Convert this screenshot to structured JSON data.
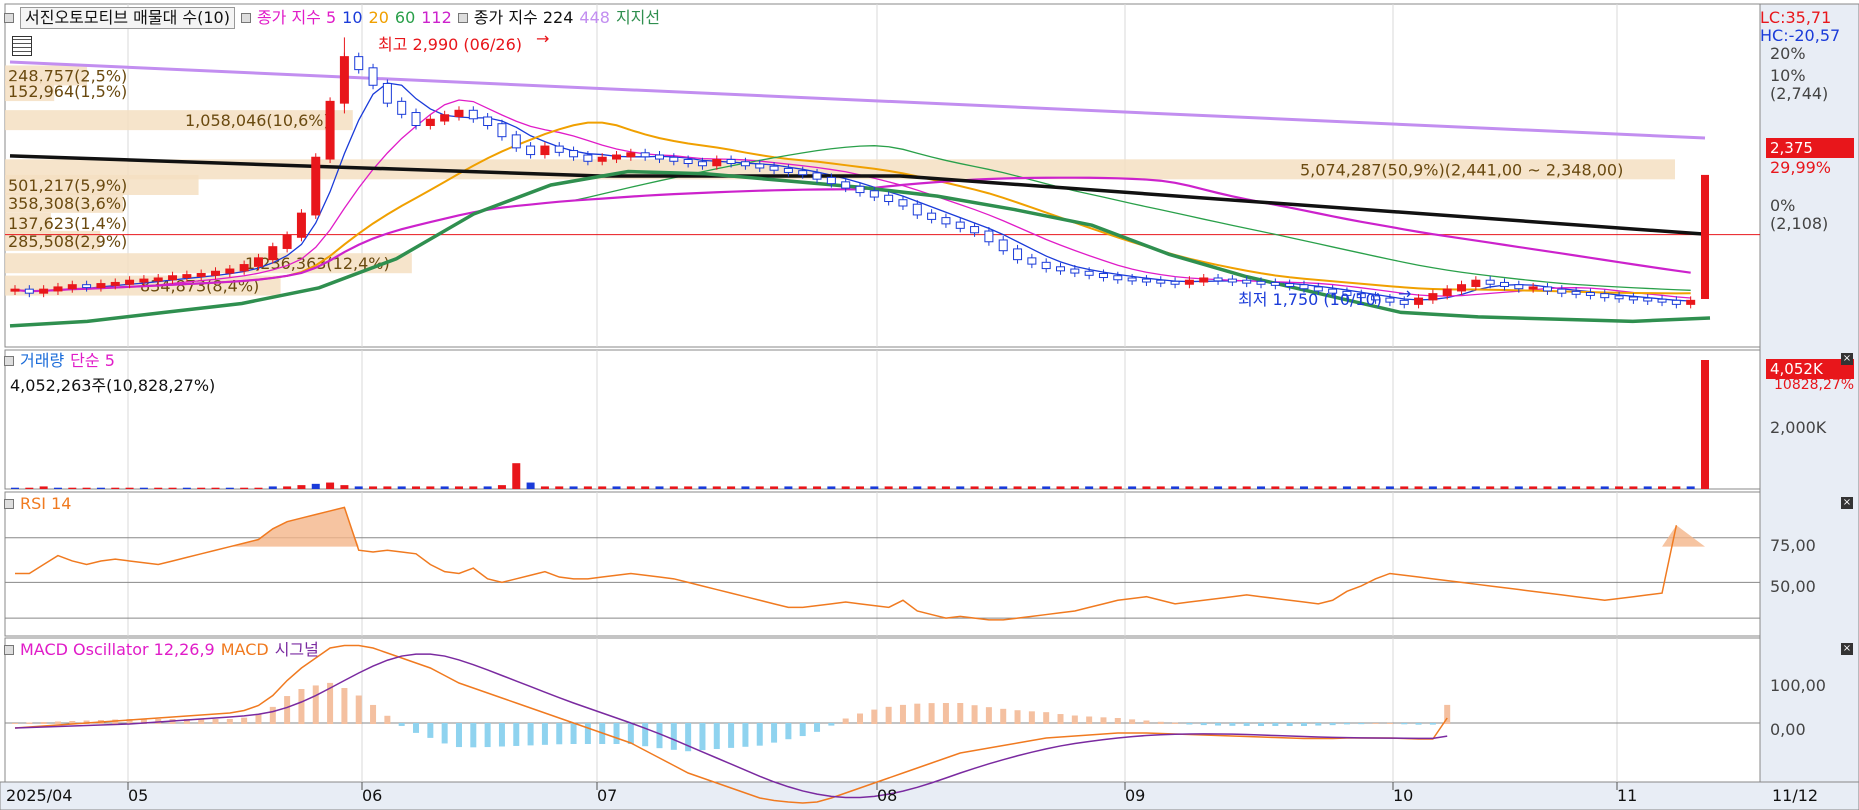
{
  "colors": {
    "up": "#e8161b",
    "down": "#1a3bd9",
    "ma5": "#1a3bd9",
    "ma10": "#e01cc8",
    "ma20": "#f0a000",
    "ma60": "#2aa04a",
    "ma112": "#cc22cc",
    "ma224": "#111111",
    "ma448": "#c28ef0",
    "support": "#2f8f4f",
    "rsi": "#f07a20",
    "macd": "#f07a20",
    "signal": "#7a2aa0"
  },
  "icons": {
    "grid": "grid-icon",
    "close": "close-icon",
    "arrow": "arrow-right-icon"
  },
  "price_panel": {
    "title": "서진오토모티브 매물대 수(10)",
    "legend": [
      {
        "label": "종가 지수 5",
        "color": "#e01cc8"
      },
      {
        "label": "10",
        "color": "#1a3bd9"
      },
      {
        "label": "20",
        "color": "#f0a000"
      },
      {
        "label": "60",
        "color": "#2aa04a"
      },
      {
        "label": "112",
        "color": "#cc22cc"
      }
    ],
    "legend2": [
      {
        "label": "종가 지수 224",
        "color": "#111111"
      },
      {
        "label": "448",
        "color": "#c28ef0"
      },
      {
        "label": "지지선",
        "color": "#2f8f4f"
      }
    ],
    "high_label": "최고 2,990 (06/26)",
    "low_label": "최저 1,750 (10/10)",
    "lc": "LC:35,71",
    "hc": "HC:-20,57",
    "current_price": "2,375",
    "current_pct": "29,99%",
    "axis": {
      "top": "20%",
      "pct10": "10%",
      "p10val": "(2,744)",
      "zero": "0%",
      "zeroval": "(2,108)"
    },
    "volume_profile": [
      {
        "label": "248,757(2,5%)",
        "price": 2820,
        "share": 2.5
      },
      {
        "label": "152,964(1,5%)",
        "price": 2750,
        "share": 1.5
      },
      {
        "label": "1,058,046(10,6%)",
        "price": 2620,
        "share": 10.6
      },
      {
        "label": "5,074,287(50,9%)(2,441,00 ~ 2,348,00)",
        "price": 2400,
        "share": 50.9
      },
      {
        "label": "501,217(5,9%)",
        "price": 2330,
        "share": 5.9
      },
      {
        "label": "358,308(3,6%)",
        "price": 2250,
        "share": 3.6
      },
      {
        "label": "137,623(1,4%)",
        "price": 2160,
        "share": 1.4
      },
      {
        "label": "285,508(2,9%)",
        "price": 2080,
        "share": 2.9
      },
      {
        "label": "1,236,363(12,4%)",
        "price": 1980,
        "share": 12.4
      },
      {
        "label": "834,873(8,4%)",
        "price": 1880,
        "share": 8.4
      }
    ]
  },
  "volume_panel": {
    "legend": [
      {
        "label": "거래량",
        "color": "#1a6bd9"
      },
      {
        "label": "단순 5",
        "color": "#e01cc8"
      }
    ],
    "info": "4,052,263주(10,828,27%)",
    "current": "4,052K",
    "current_pct": "10828,27%",
    "axis_label": "2,000K"
  },
  "rsi_panel": {
    "legend": "RSI 14",
    "axis": [
      "75,00",
      "50,00"
    ]
  },
  "macd_panel": {
    "legend": [
      {
        "label": "MACD Oscillator 12,26,9",
        "color": "#e01cc8"
      },
      {
        "label": "MACD",
        "color": "#f07a20"
      },
      {
        "label": "시그널",
        "color": "#7a2aa0"
      }
    ],
    "axis": [
      "100,00",
      "0,00"
    ]
  },
  "x_axis": {
    "labels": [
      "2025/04",
      "05",
      "06",
      "07",
      "08",
      "09",
      "10",
      "11"
    ],
    "right_label": "11/12"
  },
  "chart_data": {
    "type": "candlestick",
    "title": "서진오토모티브",
    "ylim": [
      1650,
      3050
    ],
    "closes": [
      1860,
      1850,
      1860,
      1870,
      1880,
      1875,
      1885,
      1890,
      1900,
      1905,
      1910,
      1920,
      1925,
      1930,
      1940,
      1950,
      1970,
      2000,
      2050,
      2100,
      2200,
      2450,
      2700,
      2900,
      2850,
      2780,
      2700,
      2650,
      2600,
      2620,
      2640,
      2660,
      2630,
      2600,
      2550,
      2500,
      2470,
      2500,
      2480,
      2460,
      2440,
      2450,
      2460,
      2470,
      2460,
      2450,
      2440,
      2430,
      2420,
      2440,
      2430,
      2420,
      2410,
      2400,
      2390,
      2380,
      2360,
      2340,
      2320,
      2300,
      2280,
      2260,
      2240,
      2200,
      2180,
      2160,
      2140,
      2120,
      2080,
      2040,
      2000,
      1980,
      1960,
      1950,
      1940,
      1930,
      1920,
      1910,
      1905,
      1900,
      1895,
      1890,
      1900,
      1910,
      1905,
      1900,
      1895,
      1890,
      1885,
      1880,
      1870,
      1860,
      1850,
      1840,
      1830,
      1820,
      1810,
      1800,
      1820,
      1840,
      1860,
      1880,
      1900,
      1890,
      1880,
      1870,
      1870,
      1860,
      1850,
      1845,
      1840,
      1830,
      1825,
      1820,
      1815,
      1810,
      1800,
      1810,
      2375
    ],
    "volume_rel": [
      0.01,
      0.01,
      0.02,
      0.01,
      0.01,
      0.01,
      0.01,
      0.01,
      0.01,
      0.01,
      0.01,
      0.01,
      0.01,
      0.01,
      0.01,
      0.01,
      0.01,
      0.01,
      0.02,
      0.02,
      0.03,
      0.04,
      0.05,
      0.03,
      0.02,
      0.02,
      0.02,
      0.02,
      0.02,
      0.02,
      0.02,
      0.02,
      0.02,
      0.02,
      0.03,
      0.2,
      0.05,
      0.02,
      0.02,
      0.02,
      0.02,
      0.02,
      0.02,
      0.02,
      0.02,
      0.02,
      0.02,
      0.02,
      0.02,
      0.02,
      0.02,
      0.02,
      0.02,
      0.02,
      0.02,
      0.02,
      0.02,
      0.02,
      0.02,
      0.02,
      0.02,
      0.02,
      0.02,
      0.02,
      0.02,
      0.02,
      0.02,
      0.02,
      0.02,
      0.02,
      0.02,
      0.02,
      0.02,
      0.02,
      0.02,
      0.02,
      0.02,
      0.02,
      0.02,
      0.02,
      0.02,
      0.02,
      0.02,
      0.02,
      0.02,
      0.02,
      0.02,
      0.02,
      0.02,
      0.02,
      0.02,
      0.02,
      0.02,
      0.02,
      0.02,
      0.02,
      0.02,
      0.02,
      0.02,
      0.02,
      0.02,
      0.02,
      0.02,
      0.02,
      0.02,
      0.02,
      0.02,
      0.02,
      0.02,
      0.02,
      0.02,
      0.02,
      0.02,
      0.02,
      0.02,
      0.02,
      0.02,
      0.02,
      1.0
    ],
    "rsi": [
      55,
      55,
      60,
      65,
      62,
      60,
      62,
      63,
      62,
      61,
      60,
      62,
      64,
      66,
      68,
      70,
      72,
      74,
      80,
      84,
      86,
      88,
      90,
      92,
      68,
      67,
      68,
      67,
      66,
      60,
      56,
      55,
      58,
      52,
      50,
      52,
      54,
      56,
      53,
      52,
      52,
      53,
      54,
      55,
      54,
      53,
      52,
      50,
      48,
      46,
      44,
      42,
      40,
      38,
      36,
      36,
      37,
      38,
      39,
      38,
      37,
      36,
      40,
      34,
      32,
      30,
      31,
      30,
      29,
      29,
      30,
      31,
      32,
      33,
      34,
      36,
      38,
      40,
      41,
      42,
      40,
      38,
      39,
      40,
      41,
      42,
      43,
      42,
      41,
      40,
      39,
      38,
      40,
      45,
      48,
      52,
      55,
      54,
      53,
      52,
      51,
      50,
      49,
      48,
      47,
      46,
      45,
      44,
      43,
      42,
      41,
      40,
      41,
      42,
      43,
      44,
      82
    ],
    "macd": [
      -10,
      -8,
      -6,
      -4,
      -2,
      0,
      2,
      4,
      6,
      8,
      10,
      12,
      14,
      16,
      18,
      20,
      25,
      35,
      55,
      85,
      110,
      130,
      150,
      155,
      155,
      150,
      140,
      130,
      120,
      110,
      95,
      80,
      70,
      60,
      50,
      40,
      30,
      20,
      10,
      0,
      -10,
      -20,
      -30,
      -40,
      -55,
      -70,
      -85,
      -100,
      -110,
      -120,
      -130,
      -140,
      -150,
      -155,
      -158,
      -160,
      -158,
      -150,
      -140,
      -130,
      -120,
      -110,
      -100,
      -90,
      -80,
      -70,
      -60,
      -55,
      -50,
      -45,
      -40,
      -35,
      -30,
      -28,
      -26,
      -24,
      -22,
      -20,
      -20,
      -20,
      -21,
      -22,
      -23,
      -24,
      -25,
      -26,
      -27,
      -28,
      -29,
      -30,
      -31,
      -31,
      -31,
      -30,
      -30,
      -30,
      -30,
      -31,
      -32,
      -32,
      10
    ],
    "x_labels": [
      "2025/04",
      "05",
      "06",
      "07",
      "08",
      "09",
      "10",
      "11"
    ]
  }
}
